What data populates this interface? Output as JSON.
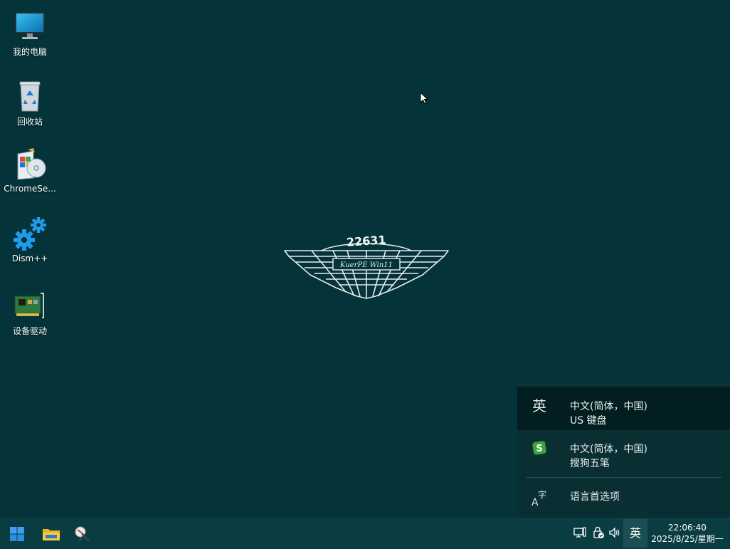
{
  "desktop": {
    "icons": [
      {
        "label": "我的电脑",
        "icon": "computer-icon"
      },
      {
        "label": "回收站",
        "icon": "recycle-bin-icon"
      },
      {
        "label": "ChromeSe...",
        "icon": "installer-icon"
      },
      {
        "label": "Dism++",
        "icon": "gears-icon"
      },
      {
        "label": "设备驱动",
        "icon": "pci-card-icon"
      }
    ],
    "logo": {
      "number": "22631",
      "text": "KuerPE Win11"
    }
  },
  "ime_flyout": {
    "items": [
      {
        "icon_char": "英",
        "line1": "中文(简体，中国)",
        "line2": "US 键盘",
        "selected": true
      },
      {
        "icon": "sogou-icon",
        "line1": "中文(简体，中国)",
        "line2": "搜狗五笔",
        "selected": false
      }
    ],
    "preferences_label": "语言首选项"
  },
  "taskbar": {
    "start_icon": "windows-start-icon",
    "pinned": [
      "file-explorer-icon",
      "snipping-tool-icon"
    ],
    "tray": [
      "network-icon",
      "security-icon",
      "volume-icon"
    ],
    "lang_indicator": "英",
    "time": "22:06:40",
    "date": "2025/8/25/星期一"
  },
  "colors": {
    "desktop_bg": "#043339",
    "taskbar_bg": "#0a3d41",
    "flyout_bg": "#0a2f32",
    "flyout_selected": "#021e20"
  }
}
